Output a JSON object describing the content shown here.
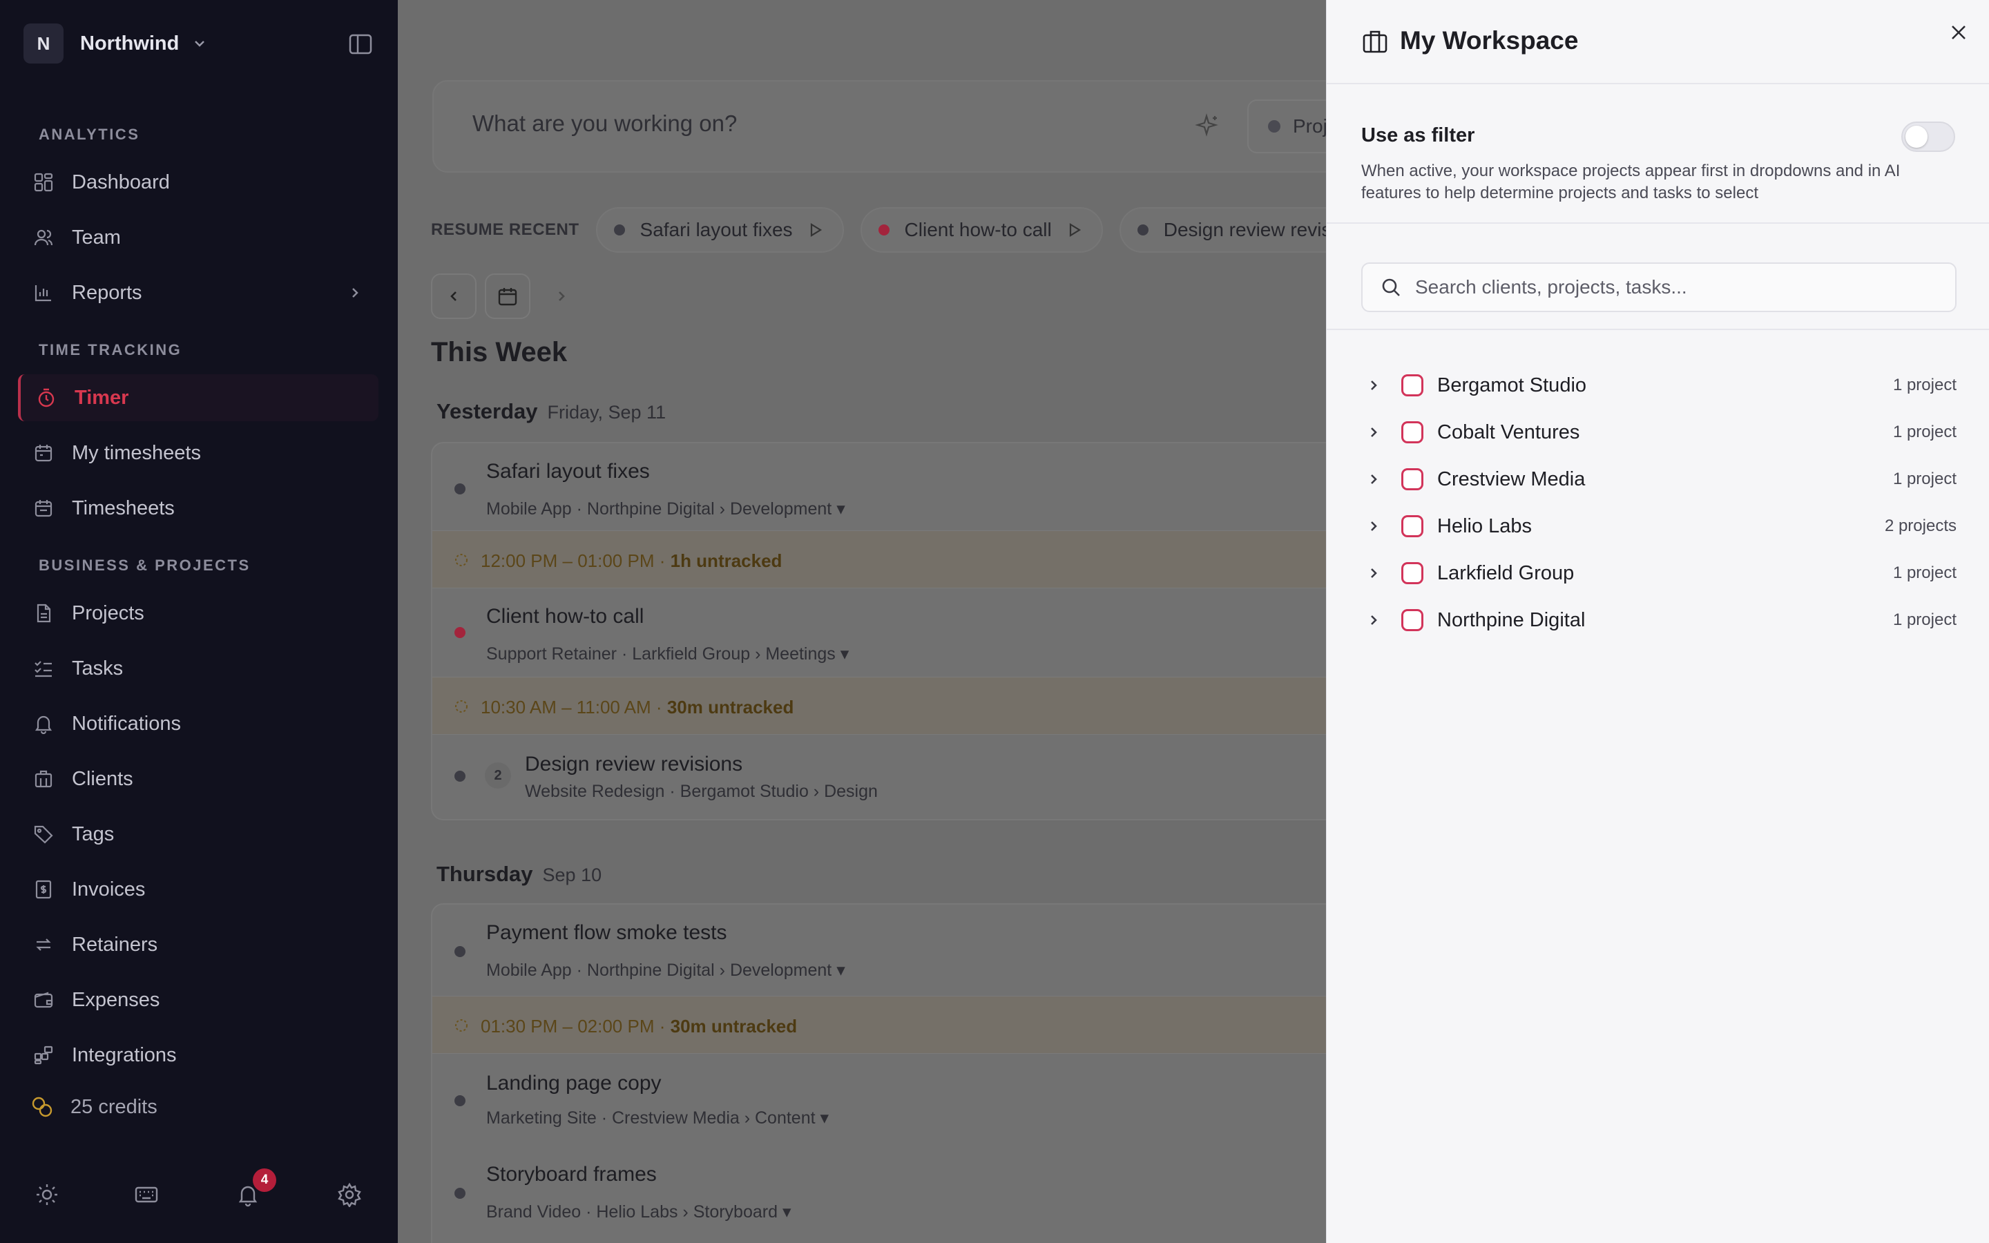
{
  "workspace": {
    "initial": "N",
    "name": "Northwind"
  },
  "sidebar": {
    "sections": [
      "ANALYTICS",
      "TIME TRACKING",
      "BUSINESS & PROJECTS"
    ],
    "items": [
      {
        "label": "Dashboard"
      },
      {
        "label": "Team"
      },
      {
        "label": "Reports"
      },
      {
        "label": "Timer"
      },
      {
        "label": "My timesheets"
      },
      {
        "label": "Timesheets"
      },
      {
        "label": "Projects"
      },
      {
        "label": "Tasks"
      },
      {
        "label": "Notifications"
      },
      {
        "label": "Clients"
      },
      {
        "label": "Tags"
      },
      {
        "label": "Invoices"
      },
      {
        "label": "Retainers"
      },
      {
        "label": "Expenses"
      },
      {
        "label": "Integrations"
      }
    ],
    "credits": "25 credits",
    "notification_count": "4"
  },
  "timer": {
    "placeholder": "What are you working on?",
    "project_label": "Project"
  },
  "resume": {
    "title": "RESUME RECENT",
    "chips": [
      {
        "label": "Safari layout fixes",
        "color": "#3c3c44"
      },
      {
        "label": "Client how-to call",
        "color": "#a3243c"
      },
      {
        "label": "Design review revisions",
        "color": "#3c3c44"
      }
    ]
  },
  "week": {
    "title": "This Week",
    "days": [
      {
        "day": "Yesterday",
        "date": "Friday, Sep 11",
        "entries": [
          {
            "title": "Safari layout fixes",
            "sub": "Mobile App · Northpine Digital › Development ▾"
          },
          {
            "gap": "12:00 PM – 01:00 PM ·",
            "gap_bold": "1h untracked"
          },
          {
            "title": "Client how-to call",
            "sub": "Support Retainer · Larkfield Group › Meetings ▾"
          },
          {
            "gap": "10:30 AM – 11:00 AM ·",
            "gap_bold": "30m untracked"
          },
          {
            "title": "Design review revisions",
            "sub": "Website Redesign · Bergamot Studio › Design",
            "count": "2"
          }
        ]
      },
      {
        "day": "Thursday",
        "date": "Sep 10",
        "entries": [
          {
            "title": "Payment flow smoke tests",
            "sub": "Mobile App · Northpine Digital › Development ▾"
          },
          {
            "gap": "01:30 PM – 02:00 PM ·",
            "gap_bold": "30m untracked"
          },
          {
            "title": "Landing page copy",
            "sub": "Marketing Site · Crestview Media › Content ▾"
          },
          {
            "title": "Storyboard frames",
            "sub": "Brand Video · Helio Labs › Storyboard ▾"
          }
        ]
      }
    ]
  },
  "panel": {
    "title": "My Workspace",
    "filter_label": "Use as filter",
    "filter_on": false,
    "filter_desc": "When active, your workspace projects appear first in dropdowns and in AI features to help determine projects and tasks to select",
    "search_placeholder": "Search clients, projects, tasks...",
    "clients": [
      {
        "name": "Bergamot Studio",
        "count": "1 project"
      },
      {
        "name": "Cobalt Ventures",
        "count": "1 project"
      },
      {
        "name": "Crestview Media",
        "count": "1 project"
      },
      {
        "name": "Helio Labs",
        "count": "2 projects"
      },
      {
        "name": "Larkfield Group",
        "count": "1 project"
      },
      {
        "name": "Northpine Digital",
        "count": "1 project"
      }
    ]
  },
  "colors": {
    "accent": "#d2345a",
    "sidebar_bg": "#11111e",
    "panel_bg": "#f6f6f8"
  }
}
